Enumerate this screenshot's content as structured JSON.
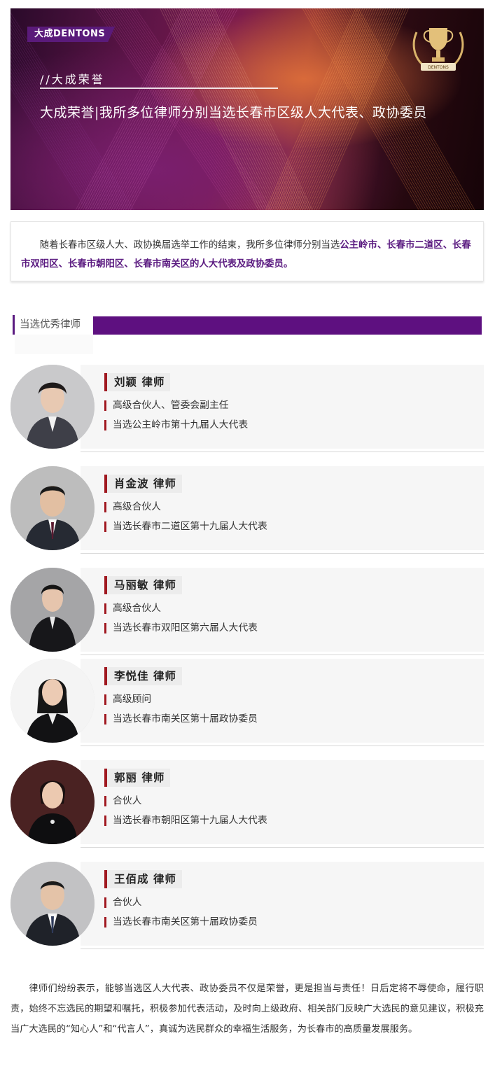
{
  "banner": {
    "logo": "大成DENTONS",
    "tagline": "//大成荣誉",
    "title": "大成荣誉|我所多位律师分别当选长春市区级人大代表、政协委员",
    "trophy_label": "DENTONS"
  },
  "intro": {
    "prefix": "随着长春市区级人大、政协换届选举工作的结束，我所多位律师分别当选",
    "highlight": "公主岭市、长春市二道区、长春市双阳区、长春市朝阳区、长春市南关区的人大代表及政协委员。"
  },
  "section": {
    "title": "当选优秀律师"
  },
  "lawyers": [
    {
      "name": "刘颖 律师",
      "role": "高级合伙人、管委会副主任",
      "elected": "当选公主岭市第十九届人大代表"
    },
    {
      "name": "肖金波 律师",
      "role": "高级合伙人",
      "elected": "当选长春市二道区第十九届人大代表"
    },
    {
      "name": "马丽敏 律师",
      "role": "高级合伙人",
      "elected": "当选长春市双阳区第六届人大代表"
    },
    {
      "name": "李悦佳 律师",
      "role": "高级顾问",
      "elected": "当选长春市南关区第十届政协委员"
    },
    {
      "name": "郭丽 律师",
      "role": "合伙人",
      "elected": "当选长春市朝阳区第十九届人大代表"
    },
    {
      "name": "王佰成 律师",
      "role": "合伙人",
      "elected": "当选长春市南关区第十届政协委员"
    }
  ],
  "closing": "律师们纷纷表示，能够当选区人大代表、政协委员不仅是荣誉，更是担当与责任！日后定将不辱使命，履行职责，始终不忘选民的期望和嘱托，积极参加代表活动，及时向上级政府、相关部门反映广大选民的意见建议，积极充当广大选民的“知心人”和“代言人”，真诚为选民群众的幸福生活服务，为长春市的高质量发展服务。",
  "colors": {
    "brand_purple": "#5e1080",
    "accent_red": "#a01820"
  }
}
